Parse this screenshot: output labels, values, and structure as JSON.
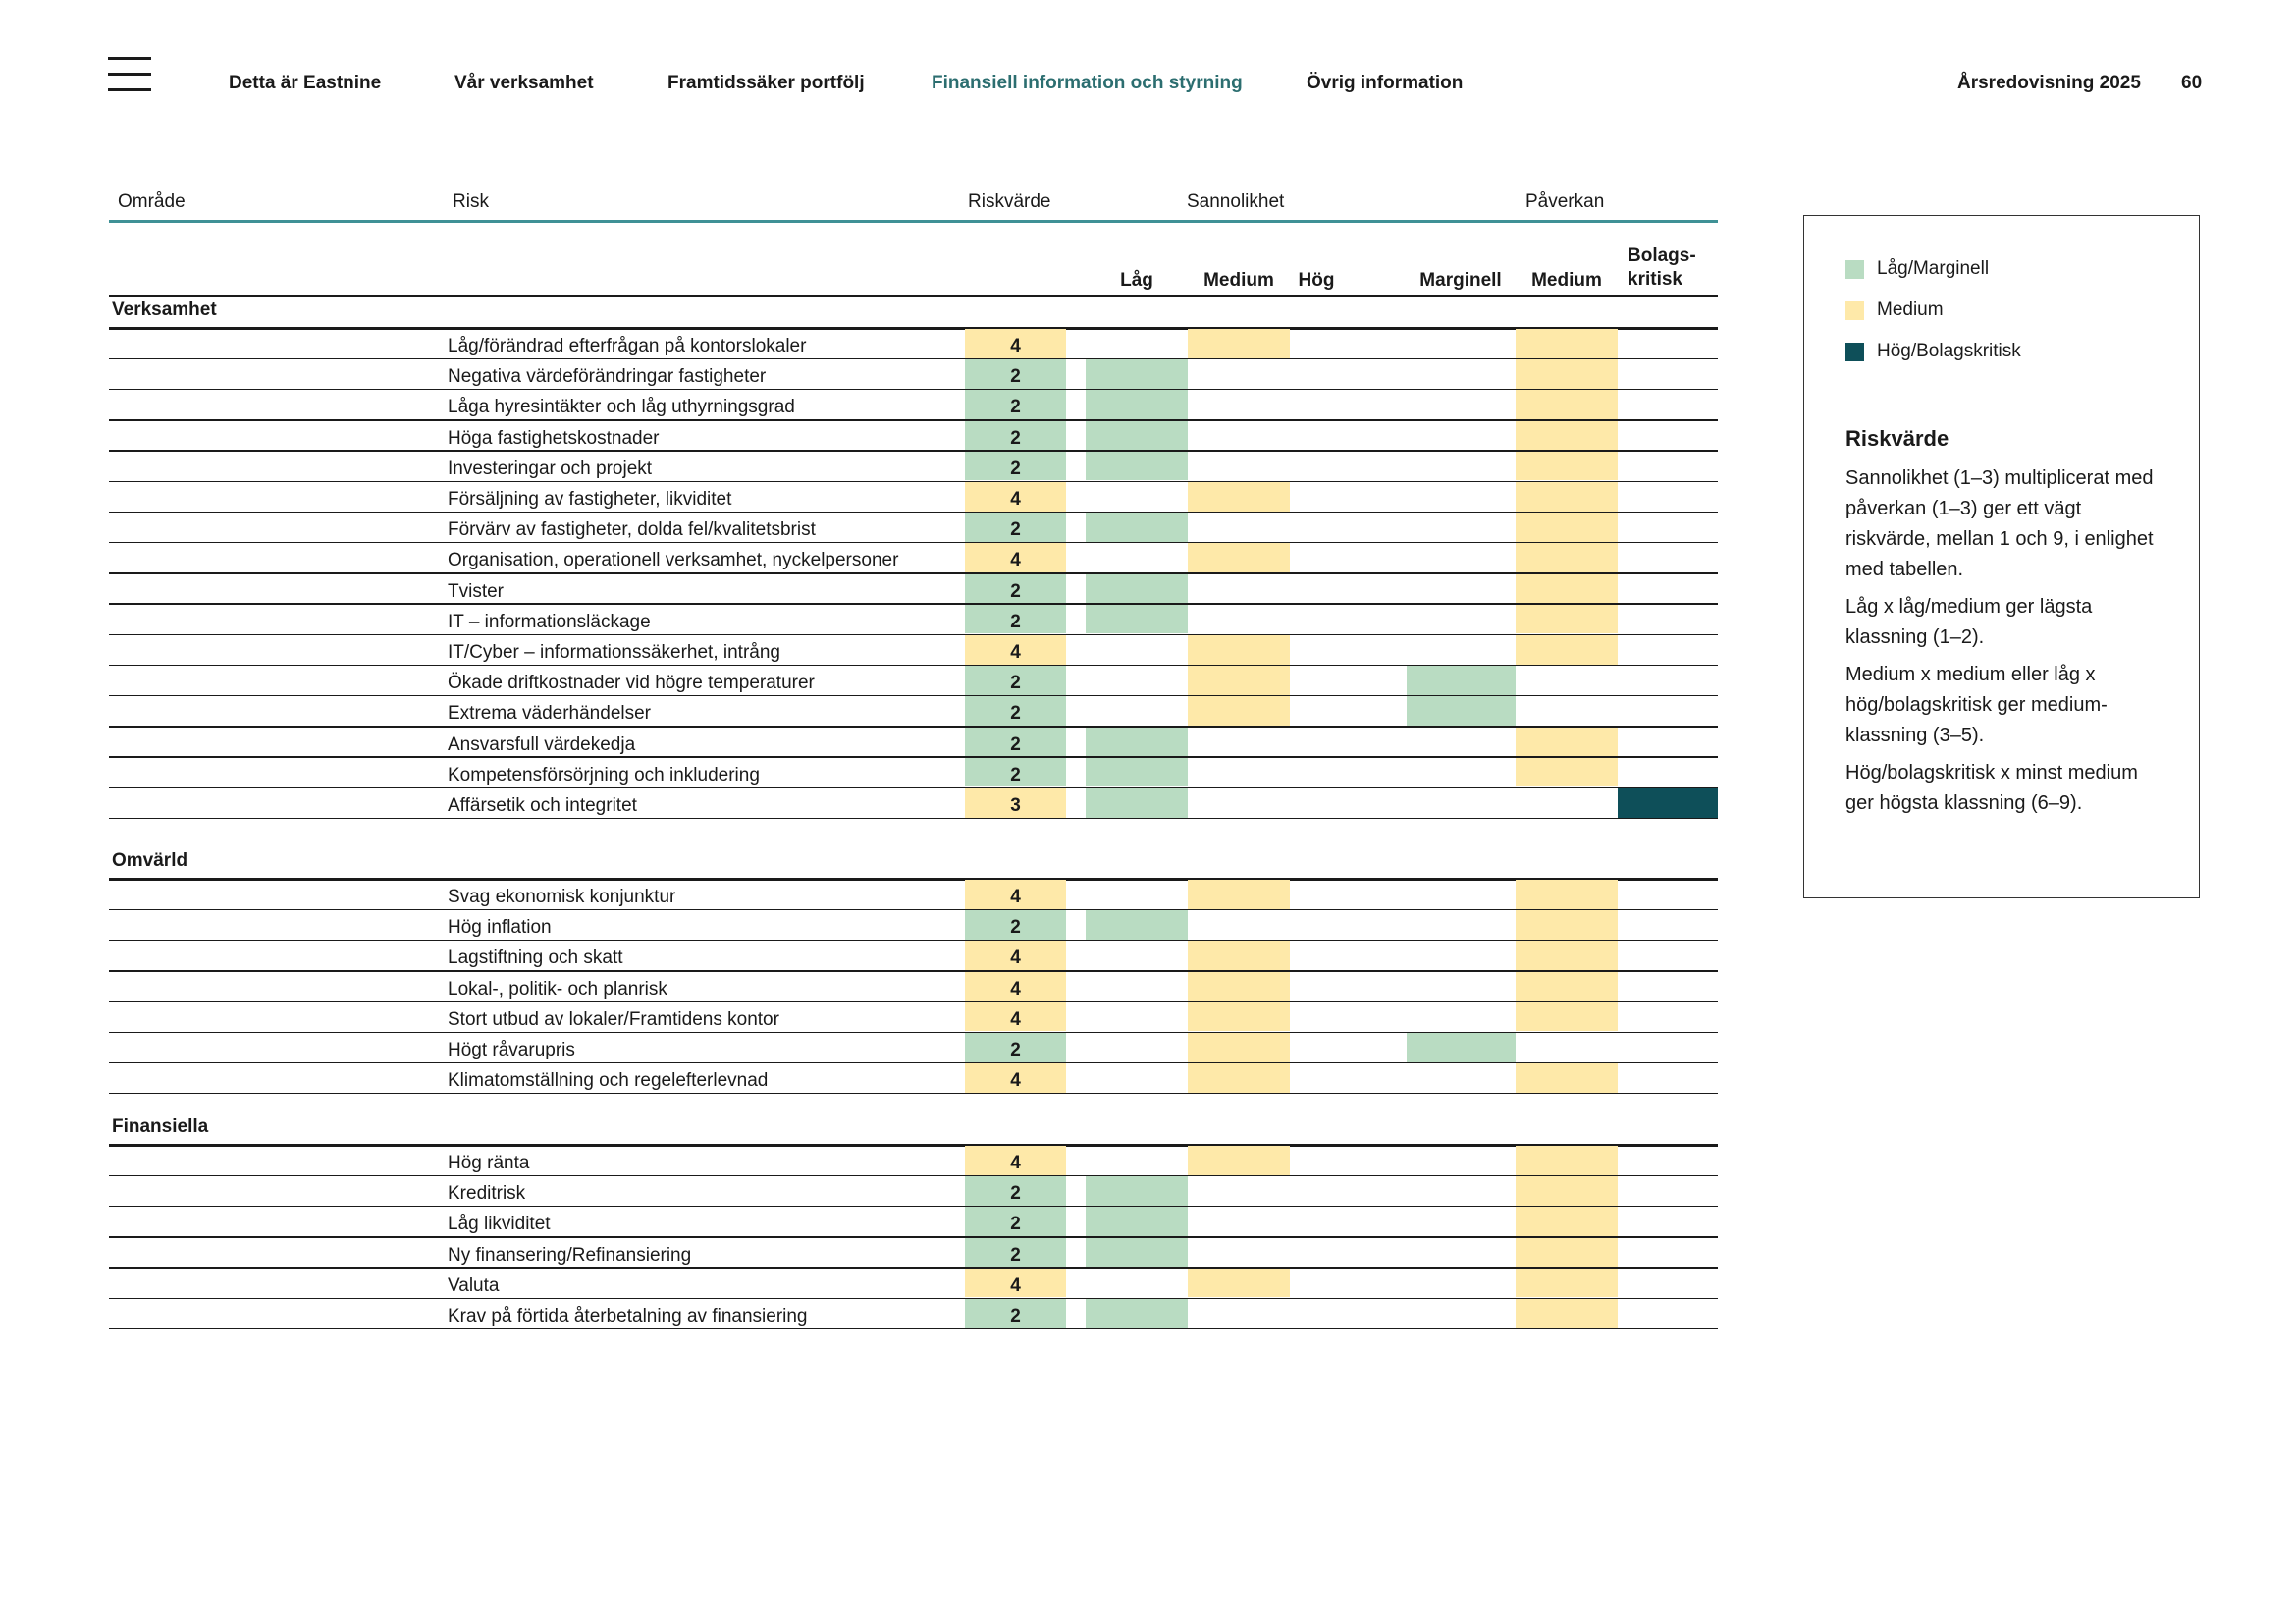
{
  "header": {
    "nav": [
      {
        "label": "Detta är Eastnine",
        "active": false
      },
      {
        "label": "Vår verksamhet",
        "active": false
      },
      {
        "label": "Framtidssäker portfölj",
        "active": false
      },
      {
        "label": "Finansiell information och styrning",
        "active": true
      },
      {
        "label": "Övrig information",
        "active": false
      }
    ],
    "report_title": "Årsredovisning 2025",
    "page_number": "60"
  },
  "colors": {
    "low": "#b9dcc2",
    "medium": "#fee9a9",
    "high": "#0e4f59",
    "accent": "#3f9196",
    "active_nav": "#2c6e70"
  },
  "table": {
    "columns": {
      "area": "Område",
      "risk": "Risk",
      "risk_value": "Riskvärde",
      "likelihood": "Sannolikhet",
      "impact": "Påverkan"
    },
    "likelihood_levels": [
      "Låg",
      "Medium",
      "Hög"
    ],
    "impact_levels": [
      "Marginell",
      "Medium",
      "Bolags-\nkritisk"
    ],
    "sections": [
      {
        "title": "Verksamhet",
        "rows": [
          {
            "risk": "Låg/förändrad efterfrågan på kontorslokaler",
            "value": "4",
            "likelihood": "Medium",
            "impact": "Medium"
          },
          {
            "risk": "Negativa värdeförändringar fastigheter",
            "value": "2",
            "likelihood": "Låg",
            "impact": "Medium"
          },
          {
            "risk": "Låga hyresintäkter och låg uthyrningsgrad",
            "value": "2",
            "likelihood": "Låg",
            "impact": "Medium"
          },
          {
            "risk": "Höga fastighetskostnader",
            "value": "2",
            "likelihood": "Låg",
            "impact": "Medium"
          },
          {
            "risk": "Investeringar och projekt",
            "value": "2",
            "likelihood": "Låg",
            "impact": "Medium"
          },
          {
            "risk": "Försäljning av fastigheter, likviditet",
            "value": "4",
            "likelihood": "Medium",
            "impact": "Medium"
          },
          {
            "risk": "Förvärv av fastigheter, dolda fel/kvalitetsbrist",
            "value": "2",
            "likelihood": "Låg",
            "impact": "Medium"
          },
          {
            "risk": "Organisation, operationell verksamhet, nyckelpersoner",
            "value": "4",
            "likelihood": "Medium",
            "impact": "Medium"
          },
          {
            "risk": "Tvister",
            "value": "2",
            "likelihood": "Låg",
            "impact": "Medium"
          },
          {
            "risk": "IT – informationsläckage",
            "value": "2",
            "likelihood": "Låg",
            "impact": "Medium"
          },
          {
            "risk": "IT/Cyber – informationssäkerhet, intrång",
            "value": "4",
            "likelihood": "Medium",
            "impact": "Medium"
          },
          {
            "risk": "Ökade driftkostnader vid högre temperaturer",
            "value": "2",
            "likelihood": "Medium",
            "impact": "Marginell"
          },
          {
            "risk": "Extrema väderhändelser",
            "value": "2",
            "likelihood": "Medium",
            "impact": "Marginell"
          },
          {
            "risk": "Ansvarsfull värdekedja",
            "value": "2",
            "likelihood": "Låg",
            "impact": "Medium"
          },
          {
            "risk": "Kompetensförsörjning och inkludering",
            "value": "2",
            "likelihood": "Låg",
            "impact": "Medium"
          },
          {
            "risk": "Affärsetik och integritet",
            "value": "3",
            "likelihood": "Låg",
            "impact": "Bolagskritisk"
          }
        ]
      },
      {
        "title": "Omvärld",
        "rows": [
          {
            "risk": "Svag ekonomisk konjunktur",
            "value": "4",
            "likelihood": "Medium",
            "impact": "Medium"
          },
          {
            "risk": "Hög inflation",
            "value": "2",
            "likelihood": "Låg",
            "impact": "Medium"
          },
          {
            "risk": "Lagstiftning och skatt",
            "value": "4",
            "likelihood": "Medium",
            "impact": "Medium"
          },
          {
            "risk": "Lokal-, politik- och planrisk",
            "value": "4",
            "likelihood": "Medium",
            "impact": "Medium"
          },
          {
            "risk": "Stort utbud av lokaler/Framtidens kontor",
            "value": "4",
            "likelihood": "Medium",
            "impact": "Medium"
          },
          {
            "risk": "Högt råvarupris",
            "value": "2",
            "likelihood": "Medium",
            "impact": "Marginell"
          },
          {
            "risk": "Klimatomställning och regelefterlevnad",
            "value": "4",
            "likelihood": "Medium",
            "impact": "Medium"
          }
        ]
      },
      {
        "title": "Finansiella",
        "rows": [
          {
            "risk": "Hög ränta",
            "value": "4",
            "likelihood": "Medium",
            "impact": "Medium"
          },
          {
            "risk": "Kreditrisk",
            "value": "2",
            "likelihood": "Låg",
            "impact": "Medium"
          },
          {
            "risk": "Låg likviditet",
            "value": "2",
            "likelihood": "Låg",
            "impact": "Medium"
          },
          {
            "risk": "Ny finansering/Refinansiering",
            "value": "2",
            "likelihood": "Låg",
            "impact": "Medium"
          },
          {
            "risk": "Valuta",
            "value": "4",
            "likelihood": "Medium",
            "impact": "Medium"
          },
          {
            "risk": "Krav på förtida återbetalning av finansiering",
            "value": "2",
            "likelihood": "Låg",
            "impact": "Medium"
          }
        ]
      }
    ]
  },
  "legend": {
    "items": [
      {
        "label": "Låg/Marginell",
        "level": "low"
      },
      {
        "label": "Medium",
        "level": "medium"
      },
      {
        "label": "Hög/Bolagskritisk",
        "level": "high"
      }
    ],
    "heading": "Riskvärde",
    "paragraphs": [
      "Sannolikhet (1–3) multiplicerat med påverkan (1–3) ger ett vägt riskvärde, mellan 1 och 9, i enlighet med tabellen.",
      "Låg x låg/medium ger lägsta klassning (1–2).",
      "Medium x medium eller låg x hög/bolagskritisk ger medium-klassning (3–5).",
      "Hög/bolagskritisk x minst medium ger högsta klassning (6–9)."
    ]
  }
}
